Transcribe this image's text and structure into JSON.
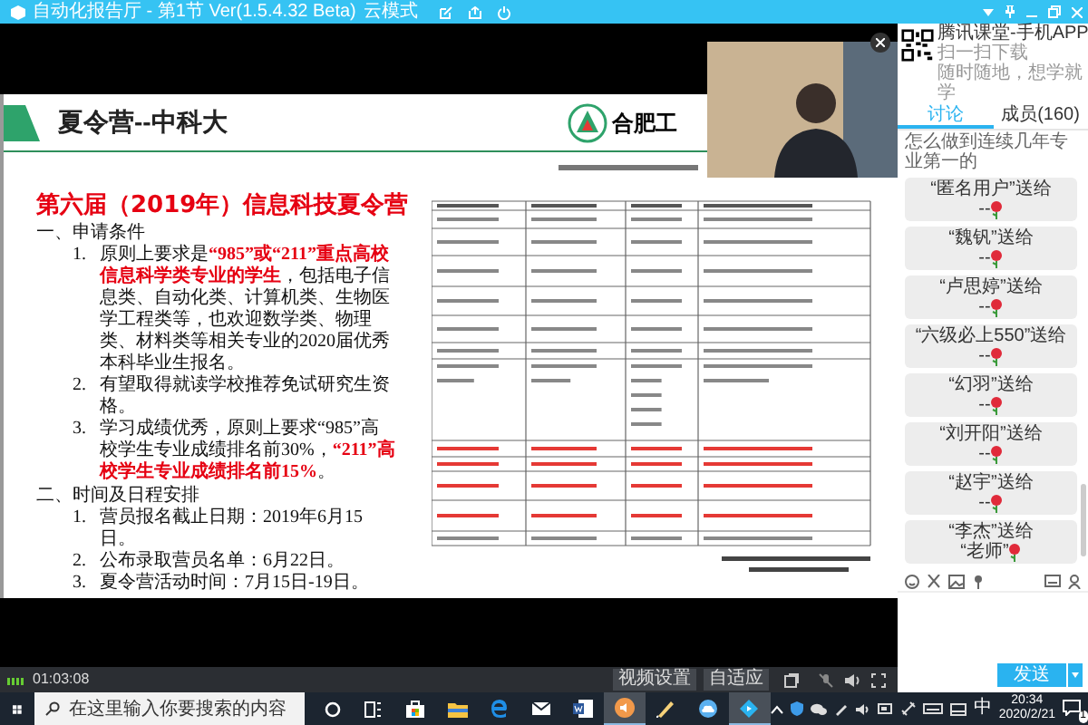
{
  "window": {
    "title": "自动化报告厅 - 第1节 Ver(1.5.4.32 Beta)",
    "mode": "云模式"
  },
  "slide": {
    "heading": "夏令营--中科大",
    "logo_text": "合肥工",
    "title": "第六届（2019年）信息科技夏令营",
    "sections": [
      {
        "heading": "一、申请条件",
        "items": [
          {
            "number": "1.",
            "text": "原则上要求是**“985”或“211”重点高校信息科学类专业的学生**，包括电子信息类、自动化类、计算机类、生物医学工程类等，也欢迎数学类、物理类、材料类等相关专业的2020届优秀本科毕业生报名。"
          },
          {
            "number": "2.",
            "text": "有望取得就读学校推荐免试研究生资格。"
          },
          {
            "number": "3.",
            "text": "学习成绩优秀，原则上要求“985”高校学生专业成绩排名前30%，**“211”高校学生专业成绩排名前15%**。"
          }
        ]
      },
      {
        "heading": "二、时间及日程安排",
        "items": [
          {
            "number": "1.",
            "text": "营员报名截止日期：2019年6月15日。"
          },
          {
            "number": "2.",
            "text": "公布录取营员名单：6月22日。"
          },
          {
            "number": "3.",
            "text": "夏令营活动时间：7月15日-19日。"
          }
        ]
      }
    ]
  },
  "video_bar": {
    "elapsed": "01:03:08",
    "buttons": [
      "视频设置",
      "自适应"
    ]
  },
  "side_panel": {
    "app_title": "腾讯课堂-手机APP",
    "app_lines": [
      "扫一扫下载",
      "随时随地，想学就学"
    ],
    "tabs": [
      {
        "label": "讨论",
        "selected": true
      },
      {
        "label": "成员(160)",
        "selected": false
      }
    ],
    "chat_partial": "怎么做到连续几年专业第一的",
    "messages": [
      {
        "line1": "“匿名用户”送给",
        "line2": "--"
      },
      {
        "line1": "“魏钒”送给",
        "line2": "--"
      },
      {
        "line1": "“卢思婷”送给",
        "line2": "--"
      },
      {
        "line1": "“六级必上550”送给",
        "line2": "--"
      },
      {
        "line1": "“幻羽”送给",
        "line2": "--"
      },
      {
        "line1": "“刘开阳”送给",
        "line2": "--"
      },
      {
        "line1": "“赵宇”送给",
        "line2": "--"
      },
      {
        "line1": "“李杰”送给",
        "line2": "“老师”"
      }
    ],
    "send_button": "发送"
  },
  "taskbar": {
    "search_placeholder": "在这里输入你要搜索的内容",
    "apps": [
      {
        "kind": "cortana",
        "active": false
      },
      {
        "kind": "taskview",
        "active": false
      },
      {
        "kind": "store",
        "active": false
      },
      {
        "kind": "explorer",
        "active": false
      },
      {
        "kind": "edge",
        "active": false
      },
      {
        "kind": "mail",
        "active": false
      },
      {
        "kind": "word",
        "active": false
      },
      {
        "kind": "audio",
        "active": true
      },
      {
        "kind": "pen",
        "active": false
      },
      {
        "kind": "cloud",
        "active": false
      },
      {
        "kind": "classroom",
        "active": true
      }
    ],
    "ime": "中",
    "time": "20:34",
    "date": "2020/2/21",
    "notifications": "1"
  }
}
